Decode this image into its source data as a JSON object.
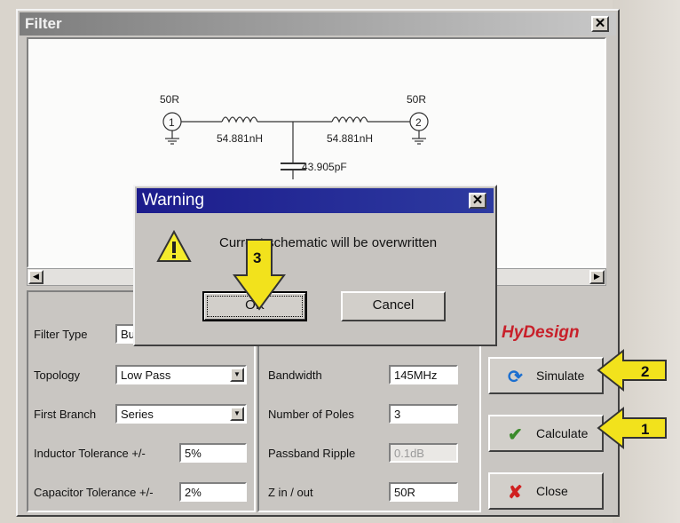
{
  "window": {
    "title": "Filter",
    "close_glyph": "✕"
  },
  "schematic": {
    "port1": {
      "label": "50R",
      "number": "1"
    },
    "port2": {
      "label": "50R",
      "number": "2"
    },
    "inductor1": "54.881nH",
    "inductor2": "54.881nH",
    "capacitor": "43.905pF"
  },
  "scrollbar": {
    "left_glyph": "◀",
    "right_glyph": "▶"
  },
  "form": {
    "filter_type": {
      "label": "Filter Type",
      "value": "Bu"
    },
    "topology": {
      "label": "Topology",
      "value": "Low Pass"
    },
    "first_branch": {
      "label": "First Branch",
      "value": "Series"
    },
    "inductor_tol": {
      "label": "Inductor Tolerance +/-",
      "value": "5%"
    },
    "capacitor_tol": {
      "label": "Capacitor Tolerance +/-",
      "value": "2%"
    },
    "bandwidth": {
      "label": "Bandwidth",
      "value": "145MHz"
    },
    "poles": {
      "label": "Number of Poles",
      "value": "3"
    },
    "ripple": {
      "label": "Passband Ripple",
      "value": "0.1dB"
    },
    "zinout": {
      "label": "Z in / out",
      "value": "50R"
    }
  },
  "brand": "HyDesign",
  "buttons": {
    "simulate": "Simulate",
    "calculate": "Calculate",
    "close": "Close"
  },
  "dialog": {
    "title": "Warning",
    "message": "Current schematic will be overwritten",
    "ok": "OK",
    "cancel": "Cancel"
  },
  "callouts": [
    "1",
    "2",
    "3"
  ],
  "colors": {
    "callout_yellow": "#f2e21c",
    "dialog_title": "#1c1c8c",
    "brand_red": "#c8202a"
  }
}
